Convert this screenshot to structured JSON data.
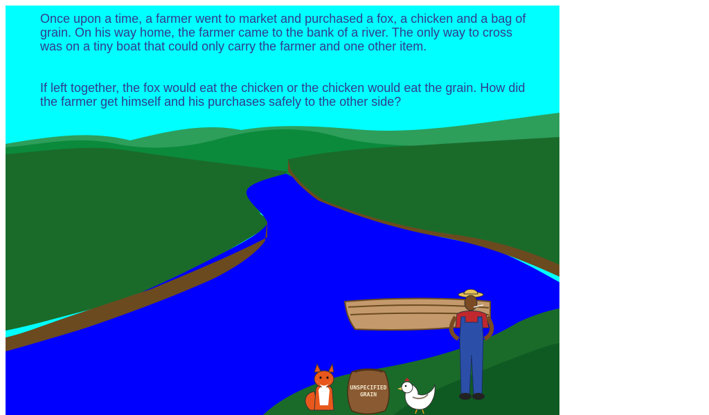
{
  "story": {
    "paragraph_1": "Once upon a time, a farmer went to market and purchased a fox, a chicken and a bag of grain. On his way home, the farmer came to the bank of a river. The only way to cross was on a tiny boat that could only carry the farmer and one other item.",
    "paragraph_2": "If left together, the fox would eat the chicken or the chicken would eat the grain. How did the farmer get himself and his purchases safely to the other side?"
  },
  "grain_bag": {
    "label_line_1": "UNSPECIFIED",
    "label_line_2": "GRAIN"
  },
  "colors": {
    "sky": "#00ffff",
    "text": "#333b8f",
    "hill_far": "#2e9e5b",
    "hill_mid": "#0b8a3c",
    "hill_near": "#1a6b2a",
    "river": "#0000ff",
    "bank": "#6b4a1f",
    "boat": "#c49a6c",
    "overalls": "#2b4fa8",
    "shirt": "#c0282e",
    "fox": "#e8581c"
  }
}
